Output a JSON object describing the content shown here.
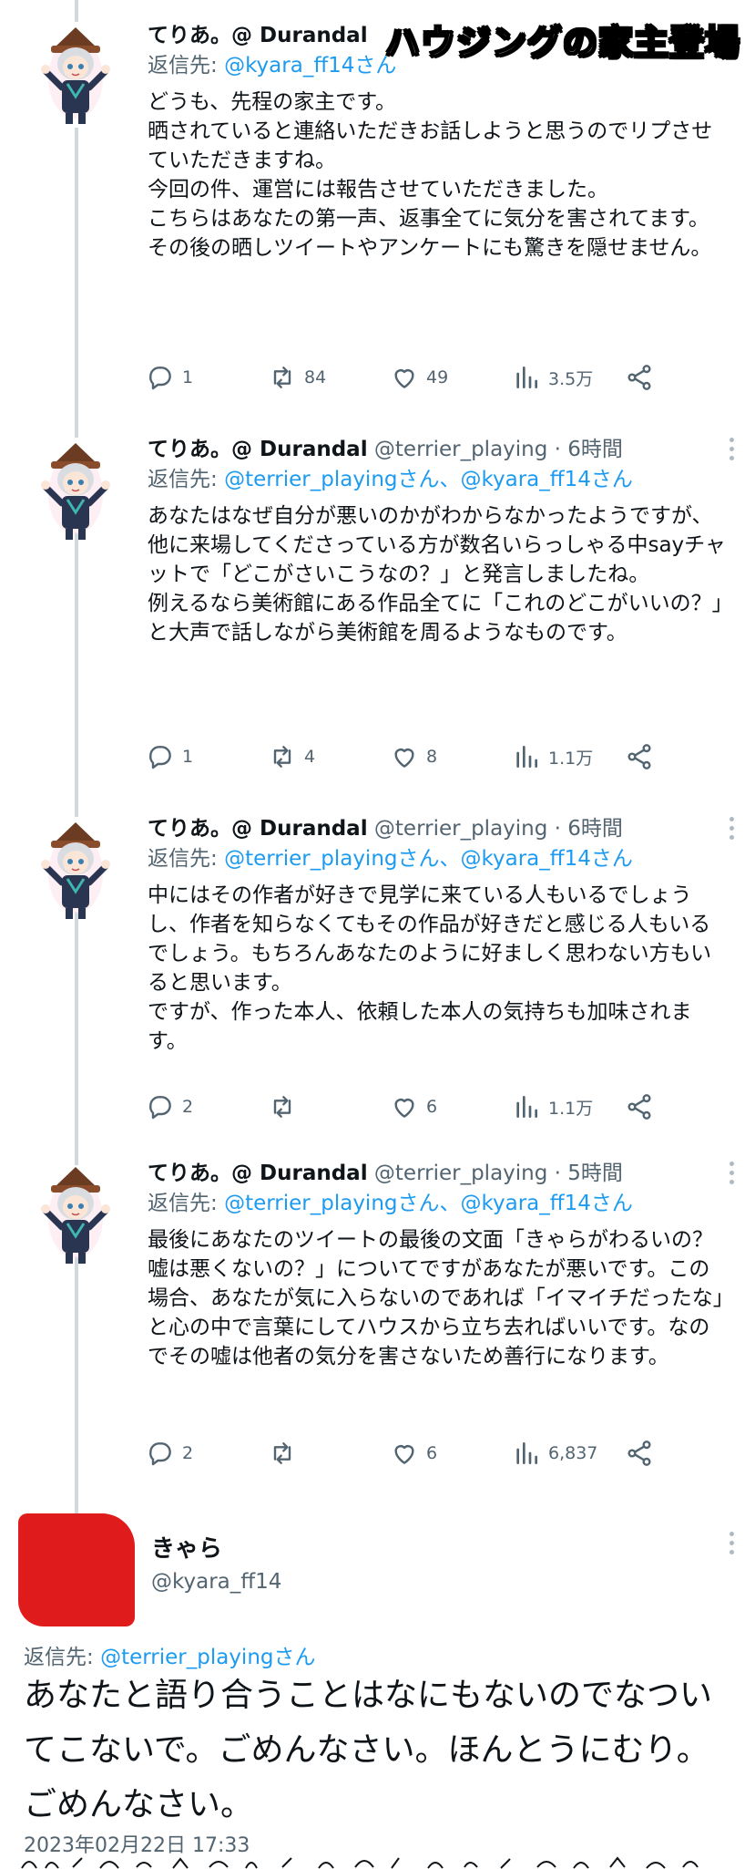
{
  "overlay_title": "ハウジングの家主登場",
  "tweets": [
    {
      "name": "てりあ。@ Durandal",
      "handle_time": "",
      "reply_prefix": "返信先: ",
      "reply_to": "@kyara_ff14さん",
      "text": "どうも、先程の家主です。\n晒されていると連絡いただきお話しようと思うのでリプさせていただきますね。\n今回の件、運営には報告させていただきました。\nこちらはあなたの第一声、返事全てに気分を害されてます。\nその後の晒しツイートやアンケートにも驚きを隠せません。",
      "replies": "1",
      "retweets": "84",
      "likes": "49",
      "views": "3.5万"
    },
    {
      "name": "てりあ。@ Durandal",
      "handle_time": "@terrier_playing · 6時間",
      "reply_prefix": "返信先: ",
      "reply_to": "@terrier_playingさん、@kyara_ff14さん",
      "text": "あなたはなぜ自分が悪いのかがわからなかったようですが、他に来場してくださっている方が数名いらっしゃる中sayチャットで「どこがさいこうなの？」と発言しましたね。\n例えるなら美術館にある作品全てに「これのどこがいいの？」と大声で話しながら美術館を周るようなものです。",
      "replies": "1",
      "retweets": "4",
      "likes": "8",
      "views": "1.1万"
    },
    {
      "name": "てりあ。@ Durandal",
      "handle_time": "@terrier_playing · 6時間",
      "reply_prefix": "返信先: ",
      "reply_to": "@terrier_playingさん、@kyara_ff14さん",
      "text": "中にはその作者が好きで見学に来ている人もいるでしょうし、作者を知らなくてもその作品が好きだと感じる人もいるでしょう。もちろんあなたのように好ましく思わない方もいると思います。\nですが、作った本人、依頼した本人の気持ちも加味されます。",
      "replies": "2",
      "retweets": "",
      "likes": "6",
      "views": "1.1万"
    },
    {
      "name": "てりあ。@ Durandal",
      "handle_time": "@terrier_playing · 5時間",
      "reply_prefix": "返信先: ",
      "reply_to": "@terrier_playingさん、@kyara_ff14さん",
      "text": "最後にあなたのツイートの最後の文面「きゃらがわるいの？嘘は悪くないの？」についてですがあなたが悪いです。この場合、あなたが気に入らないのであれば「イマイチだったな」と心の中で言葉にしてハウスから立ち去ればいいです。なのでその嘘は他者の気分を害さないため善行になります。",
      "replies": "2",
      "retweets": "",
      "likes": "6",
      "views": "6,837"
    }
  ],
  "main": {
    "name": "きゃら",
    "handle": "@kyara_ff14",
    "reply_prefix": "返信先: ",
    "reply_to": "@terrier_playingさん",
    "text": "あなたと語り合うことはなにもないのでなついてこないで。ごめんなさい。ほんとうにむり。ごめんなさい。",
    "timestamp": "2023年02月22日 17:33"
  },
  "colors": {
    "accent": "#1d9bf0",
    "muted": "#536471",
    "redacted": "#e01b1b",
    "thread": "#cfd9de"
  },
  "icons": [
    "reply-icon",
    "retweet-icon",
    "like-icon",
    "views-icon",
    "share-icon",
    "more-icon"
  ]
}
